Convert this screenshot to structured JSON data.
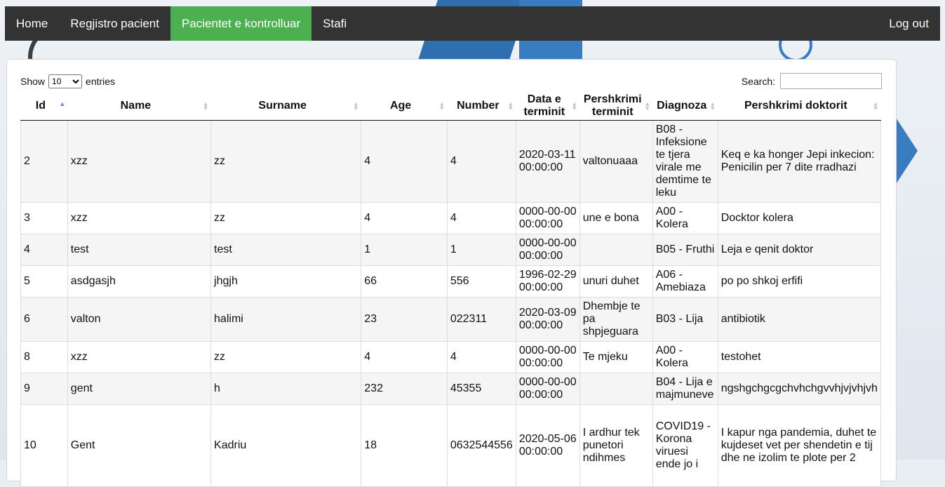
{
  "nav": {
    "items": [
      {
        "label": "Home",
        "active": false
      },
      {
        "label": "Regjistro pacient",
        "active": false
      },
      {
        "label": "Pacientet e kontrolluar",
        "active": true
      },
      {
        "label": "Stafi",
        "active": false
      }
    ],
    "logout": "Log out",
    "active_color": "#4caf50",
    "bar_color": "#333333"
  },
  "controls": {
    "show_label": "Show",
    "entries_value": "10",
    "entries_label": "entries",
    "search_label": "Search:",
    "search_value": ""
  },
  "table": {
    "columns": [
      "Id",
      "Name",
      "Surname",
      "Age",
      "Number",
      "Data e terminit",
      "Pershkrimi terminit",
      "Diagnoza",
      "Pershkrimi doktorit"
    ],
    "rows": [
      [
        "2",
        "xzz",
        "zz",
        "4",
        "4",
        "2020-03-11 00:00:00",
        "valtonuaaa",
        "B08 - Infeksione te tjera virale me demtime te leku",
        "Keq e ka honger Jepi inkecion: Penicilin per 7 dite rradhazi"
      ],
      [
        "3",
        "xzz",
        "zz",
        "4",
        "4",
        "0000-00-00 00:00:00",
        "une e bona",
        "A00 - Kolera",
        "Docktor kolera"
      ],
      [
        "4",
        "test",
        "test",
        "1",
        "1",
        "0000-00-00 00:00:00",
        "",
        "B05 - Fruthi",
        "Leja e qenit doktor"
      ],
      [
        "5",
        "asdgasjh",
        "jhgjh",
        "66",
        "556",
        "1996-02-29 00:00:00",
        "unuri duhet",
        "A06 - Amebiaza",
        "po po shkoj erfifi"
      ],
      [
        "6",
        "valton",
        "halimi",
        "23",
        "022311",
        "2020-03-09 00:00:00",
        "Dhembje te pa shpjeguara",
        "B03 - Lija",
        "antibiotik"
      ],
      [
        "8",
        "xzz",
        "zz",
        "4",
        "4",
        "0000-00-00 00:00:00",
        "Te mjeku",
        "A00 - Kolera",
        "testohet"
      ],
      [
        "9",
        "gent",
        "h",
        "232",
        "45355",
        "0000-00-00 00:00:00",
        "",
        "B04 - Lija e majmuneve",
        "ngshgchgcgchvhchgvvhjvjvhjvh"
      ],
      [
        "10",
        "Gent",
        "Kadriu",
        "18",
        "0632544556",
        "2020-05-06 00:00:00",
        "I ardhur tek punetori ndihmes",
        "COVID19 - Korona viruesi ende jo i",
        "I kapur nga pandemia, duhet te kujdeset vet per shendetin e tij dhe ne izolim te plote per 2"
      ]
    ]
  }
}
